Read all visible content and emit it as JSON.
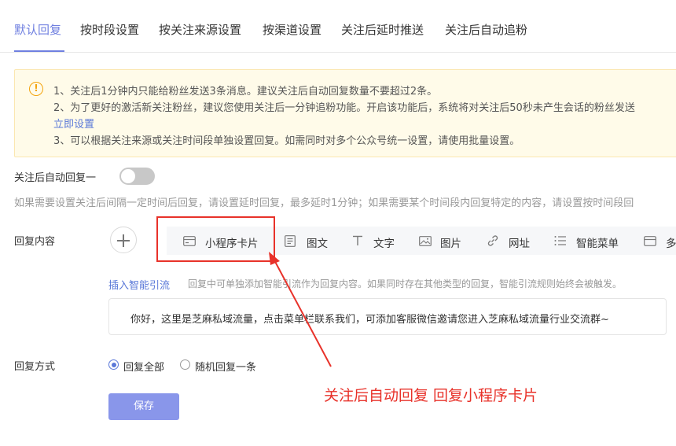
{
  "tabs": [
    {
      "label": "默认回复",
      "active": true
    },
    {
      "label": "按时段设置",
      "active": false
    },
    {
      "label": "按关注来源设置",
      "active": false
    },
    {
      "label": "按渠道设置",
      "active": false
    },
    {
      "label": "关注后延时推送",
      "active": false
    },
    {
      "label": "关注后自动追粉",
      "active": false
    }
  ],
  "notice": {
    "icon": "warning-icon",
    "lines": [
      "1、关注后1分钟内只能给粉丝发送3条消息。建议关注后自动回复数量不要超过2条。",
      "2、为了更好的激活新关注粉丝，建议您使用关注后一分钟追粉功能。开启该功能后，系统将对关注后50秒未产生会话的粉丝发送",
      "3、可以根据关注来源或关注时间段单独设置回复。如需同时对多个公众号统一设置，请使用批量设置。"
    ],
    "link": "立即设置"
  },
  "auto_reply": {
    "label": "关注后自动回复一",
    "enabled": false,
    "hint": "如果需要设置关注后间隔一定时间后回复，请设置延时回复，最多延时1分钟；如果需要某个时间段内回复特定的内容，请设置按时间段回"
  },
  "reply_content": {
    "label": "回复内容",
    "types": [
      {
        "label": "小程序卡片",
        "icon": "card-icon"
      },
      {
        "label": "图文",
        "icon": "article-icon"
      },
      {
        "label": "文字",
        "icon": "text-icon"
      },
      {
        "label": "图片",
        "icon": "image-icon"
      },
      {
        "label": "网址",
        "icon": "link-icon"
      },
      {
        "label": "智能菜单",
        "icon": "menu-icon"
      },
      {
        "label": "多",
        "icon": "card-icon"
      }
    ],
    "insert_link": "插入智能引流",
    "insert_desc": "回复中可单独添加智能引流作为回复内容。如果同时存在其他类型的回复，智能引流规则始终会被触发。",
    "message": "你好，这里是芝麻私域流量，点击菜单栏联系我们，可添加客服微信邀请您进入芝麻私域流量行业交流群~"
  },
  "reply_mode": {
    "label": "回复方式",
    "options": [
      {
        "label": "回复全部",
        "checked": true
      },
      {
        "label": "随机回复一条",
        "checked": false
      }
    ]
  },
  "save_label": "保存",
  "annotation": {
    "text": "关注后自动回复 回复小程序卡片",
    "color": "#e8322a"
  },
  "colors": {
    "accent": "#6f7fe0",
    "link": "#5a78d8",
    "warning": "#f3a30b"
  }
}
